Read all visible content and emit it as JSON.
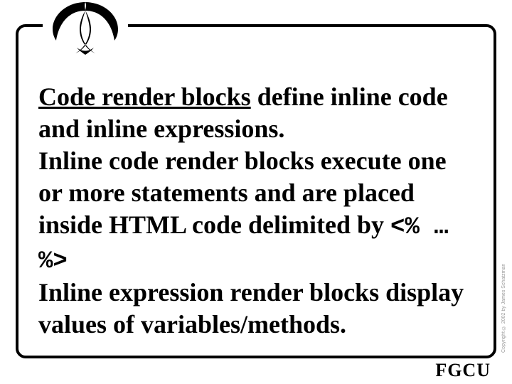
{
  "slide": {
    "title_underlined": "Code render blocks",
    "title_rest": " define inline code and inline expressions.",
    "para2_before": "Inline code render blocks execute one or more statements and are placed inside HTML code delimited by ",
    "code_open": "<%",
    "code_mid": " … ",
    "code_close": "%>",
    "para3": "Inline expression render blocks display values of variables/methods."
  },
  "footer": {
    "org": "FGCU"
  },
  "meta": {
    "copyright": "Copyright © 2002 by James Schatzman"
  }
}
